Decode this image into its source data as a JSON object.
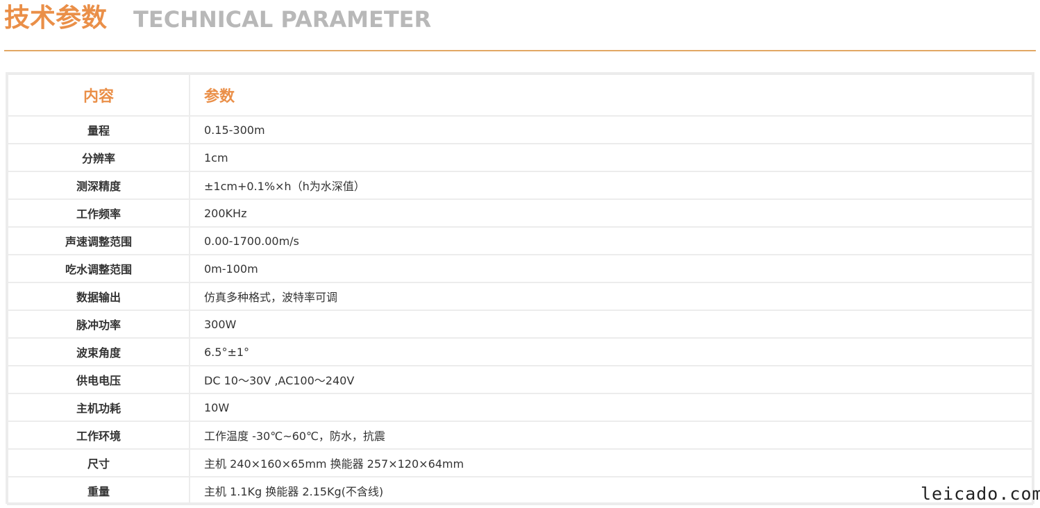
{
  "header": {
    "title_cn": "技术参数",
    "title_en": "TECHNICAL PARAMETER",
    "accent_color": "#ea8f48",
    "line_color": "#e2a764"
  },
  "table": {
    "headers": {
      "name": "内容",
      "value": "参数"
    },
    "rows": [
      {
        "name": "量程",
        "value": "0.15-300m"
      },
      {
        "name": "分辨率",
        "value": "1cm"
      },
      {
        "name": "测深精度",
        "value": "±1cm+0.1%×h（h为水深值）"
      },
      {
        "name": "工作频率",
        "value": "200KHz"
      },
      {
        "name": "声速调整范围",
        "value": "0.00-1700.00m/s"
      },
      {
        "name": "吃水调整范围",
        "value": "0m-100m"
      },
      {
        "name": "数据输出",
        "value": "仿真多种格式，波特率可调"
      },
      {
        "name": "脉冲功率",
        "value": "300W"
      },
      {
        "name": "波束角度",
        "value": "6.5°±1°"
      },
      {
        "name": "供电电压",
        "value": "DC 10～30V ,AC100～240V"
      },
      {
        "name": "主机功耗",
        "value": "10W"
      },
      {
        "name": "工作环境",
        "value": "工作温度 -30℃~60℃，防水，抗震"
      },
      {
        "name": "尺寸",
        "value": "主机 240×160×65mm  换能器 257×120×64mm"
      },
      {
        "name": "重量",
        "value": "主机 1.1Kg  换能器 2.15Kg(不含线)"
      }
    ]
  },
  "watermark": "leicado.com"
}
